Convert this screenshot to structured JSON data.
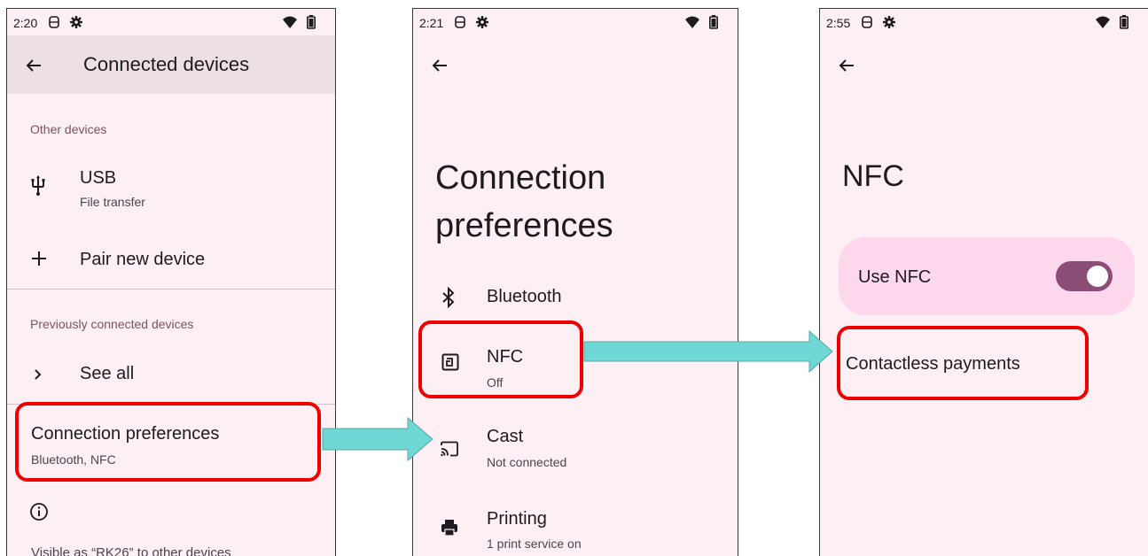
{
  "colors": {
    "screen_bg": "#fcf0f4",
    "appbar_bg": "#ece0e4",
    "section_header": "#7d5260",
    "highlight": "#ee0000",
    "arrow": "#6fd8d4",
    "toggle_on": "#8a4e78",
    "nfc_card": "#fdd7ec"
  },
  "screen1": {
    "time": "2:20",
    "title": "Connected devices",
    "other_devices_header": "Other devices",
    "usb_title": "USB",
    "usb_subtitle": "File transfer",
    "pair_new_device": "Pair new device",
    "previously_connected_header": "Previously connected devices",
    "see_all": "See all",
    "connection_preferences_title": "Connection preferences",
    "connection_preferences_subtitle": "Bluetooth, NFC",
    "visible_as": "Visible as “RK26” to other devices"
  },
  "screen2": {
    "time": "2:21",
    "title": "Connection preferences",
    "title_line1": "Connection",
    "title_line2": "preferences",
    "bluetooth": "Bluetooth",
    "nfc_title": "NFC",
    "nfc_subtitle": "Off",
    "cast_title": "Cast",
    "cast_subtitle": "Not connected",
    "printing_title": "Printing",
    "printing_subtitle": "1 print service on"
  },
  "screen3": {
    "time": "2:55",
    "title": "NFC",
    "use_nfc": "Use NFC",
    "use_nfc_enabled": true,
    "contactless_payments": "Contactless payments"
  },
  "icons": [
    "back-arrow-icon",
    "usb-icon",
    "plus-icon",
    "chevron-right-icon",
    "info-icon",
    "bluetooth-icon",
    "nfc-icon",
    "cast-icon",
    "printer-icon",
    "gear-icon",
    "sim-icon",
    "wifi-icon",
    "battery-icon"
  ]
}
